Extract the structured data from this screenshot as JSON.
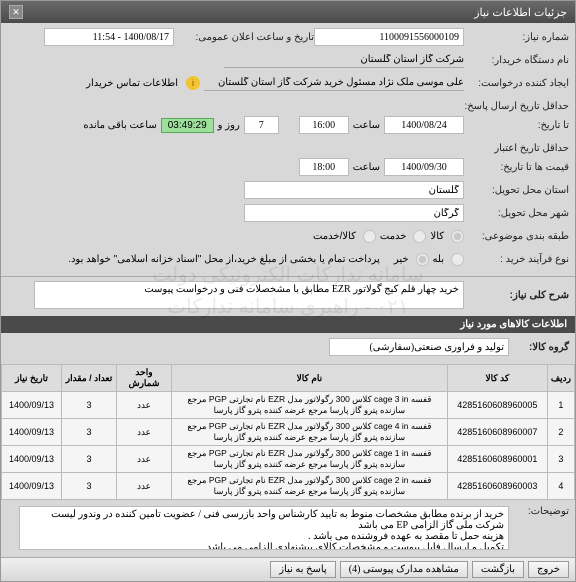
{
  "window": {
    "title": "جزئیات اطلاعات نیاز",
    "close": "✕"
  },
  "top": {
    "need_no_label": "شماره نیاز:",
    "need_no": "1100091556000109",
    "announce_label": "تاریخ و ساعت اعلان عمومی:",
    "announce": "1400/08/17 - 11:54",
    "buyer_org_label": "نام دستگاه خریدار:",
    "buyer_org": "شرکت گاز استان گلستان",
    "requester_label": "ایجاد کننده درخواست:",
    "requester": "علی موسی ملک نژاد مسئول خرید شرکت گاز استان گلستان",
    "buyer_info_icon_text": "اطلاعات تماس خریدار",
    "deadline_label": "حداقل تاریخ ارسال پاسخ:",
    "deadline_until": "تا تاریخ:",
    "deadline_date": "1400/08/24",
    "time_label": "ساعت",
    "deadline_time": "16:00",
    "days": "7",
    "days_label": "روز و",
    "timer": "03:49:29",
    "remain_label": "ساعت باقی مانده",
    "validity_label": "حداقل تاریخ اعتبار",
    "validity_until": "قیمت ها تا تاریخ:",
    "validity_date": "1400/09/30",
    "validity_time": "18:00",
    "province_label": "استان محل تحویل:",
    "province": "گلستان",
    "city_label": "شهر محل تحویل:",
    "city": "گرگان",
    "category_label": "طبقه بندی موضوعی:",
    "cat_goods": "کالا",
    "cat_service": "خدمت",
    "cat_goods_service": "کالا/خدمت",
    "process_label": "نوع فرآیند خرید :",
    "payment_note": "پرداخت تمام یا بخشی از مبلغ خرید،از محل \"اسناد خزانه اسلامی\" خواهد بود.",
    "yes": "بله",
    "no": "خیر"
  },
  "desc": {
    "title_label": "شرح کلی نیاز:",
    "title_value": "خرید چهار قلم کیج گولاتور EZR مطابق با مشخصلات فنی و درخواست پیوست",
    "goods_header": "اطلاعات کالاهای مورد نیاز",
    "group_label": "گروه کالا:",
    "group_value": "تولید و فرآوری صنعتی(سفارشی)"
  },
  "table": {
    "headers": [
      "ردیف",
      "کد کالا",
      "نام کالا",
      "واحد شمارش",
      "تعداد / مقدار",
      "تاریخ نیاز"
    ],
    "rows": [
      {
        "n": "1",
        "code": "4285160608960005",
        "name": "قفسه cage 3 in کلاس 300 رگولاتور مدل EZR نام تجارتی PGP مرجع سازنده پترو گاز پارسا مرجع عرضه کننده پترو گاز پارسا",
        "unit": "عدد",
        "qty": "3",
        "date": "1400/09/13"
      },
      {
        "n": "2",
        "code": "4285160608960007",
        "name": "قفسه cage 4 in کلاس 300 رگولاتور مدل EZR نام تجارتی PGP مرجع سازنده پترو گاز پارسا مرجع عرضه کننده پترو گاز پارسا",
        "unit": "عدد",
        "qty": "3",
        "date": "1400/09/13"
      },
      {
        "n": "3",
        "code": "4285160608960001",
        "name": "قفسه cage 1 in کلاس 300 رگولاتور مدل EZR نام تجارتی PGP مرجع سازنده پترو گاز پارسا مرجع عرضه کننده پترو گاز پارسا",
        "unit": "عدد",
        "qty": "3",
        "date": "1400/09/13"
      },
      {
        "n": "4",
        "code": "4285160608960003",
        "name": "قفسه cage 2 in کلاس 300 رگولاتور مدل EZR نام تجارتی PGP مرجع سازنده پترو گاز پارسا مرجع عرضه کننده پترو گاز پارسا",
        "unit": "عدد",
        "qty": "3",
        "date": "1400/09/13"
      }
    ]
  },
  "explain": {
    "label": "توضیحات:",
    "value": "خرید از برنده مطابق مشخصات منوط به تایید کارشناس واحد بازرسی فنی / عضویت تامین کننده در وندور لیست شرکت ملی گاز الزامی EP می باشد\nهزینه حمل تا مقصد به عهده فروشنده می باشد .\nتکمیل و ارسال فایل پیوست و مشخصات کالای پیشنهادی الزامی می باشد"
  },
  "footer": {
    "exit": "خروج",
    "back": "بازگشت",
    "attach": "مشاهده مدارک پیوستی (4)",
    "reply": "پاسخ به نیاز"
  },
  "watermark": "سامانه تدارکات الکترونیکی دولت\n۰۲۱ - راهبری سامانه تدارکات"
}
